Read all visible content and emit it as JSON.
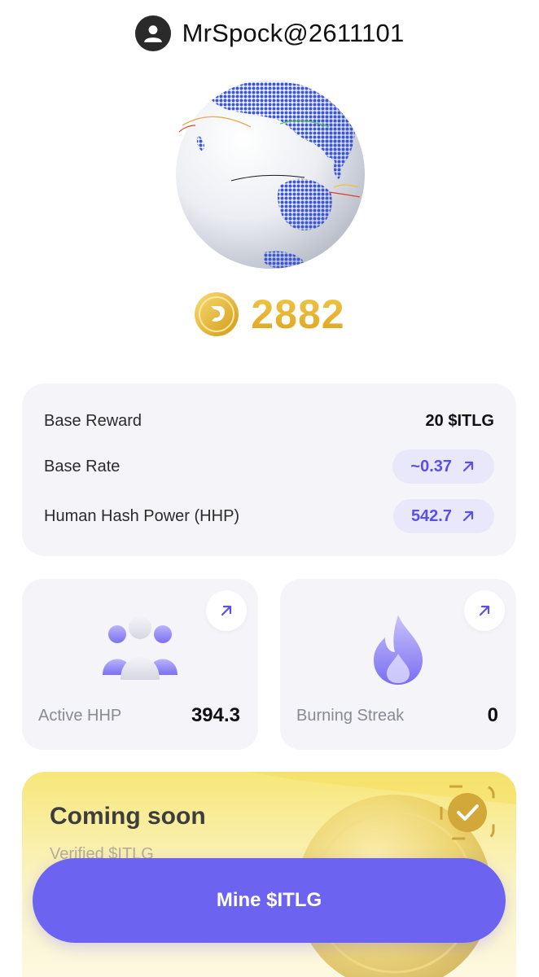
{
  "header": {
    "username": "MrSpock@2611101"
  },
  "balance": {
    "value": "2882"
  },
  "stats": {
    "base_reward": {
      "label": "Base Reward",
      "value": "20 $ITLG"
    },
    "base_rate": {
      "label": "Base Rate",
      "value": "~0.37"
    },
    "hhp": {
      "label": "Human Hash Power (HHP)",
      "value": "542.7"
    }
  },
  "cards": {
    "active_hhp": {
      "label": "Active HHP",
      "value": "394.3"
    },
    "burning_streak": {
      "label": "Burning Streak",
      "value": "0"
    }
  },
  "banner": {
    "title": "Coming soon",
    "subtitle": "Verified $ITLG"
  },
  "mine_button": {
    "label": "Mine $ITLG"
  },
  "colors": {
    "accent": "#6C63F0",
    "gold": "#E9B52C",
    "card_bg": "#F4F4F9",
    "pill_bg": "#E9E8FB"
  }
}
